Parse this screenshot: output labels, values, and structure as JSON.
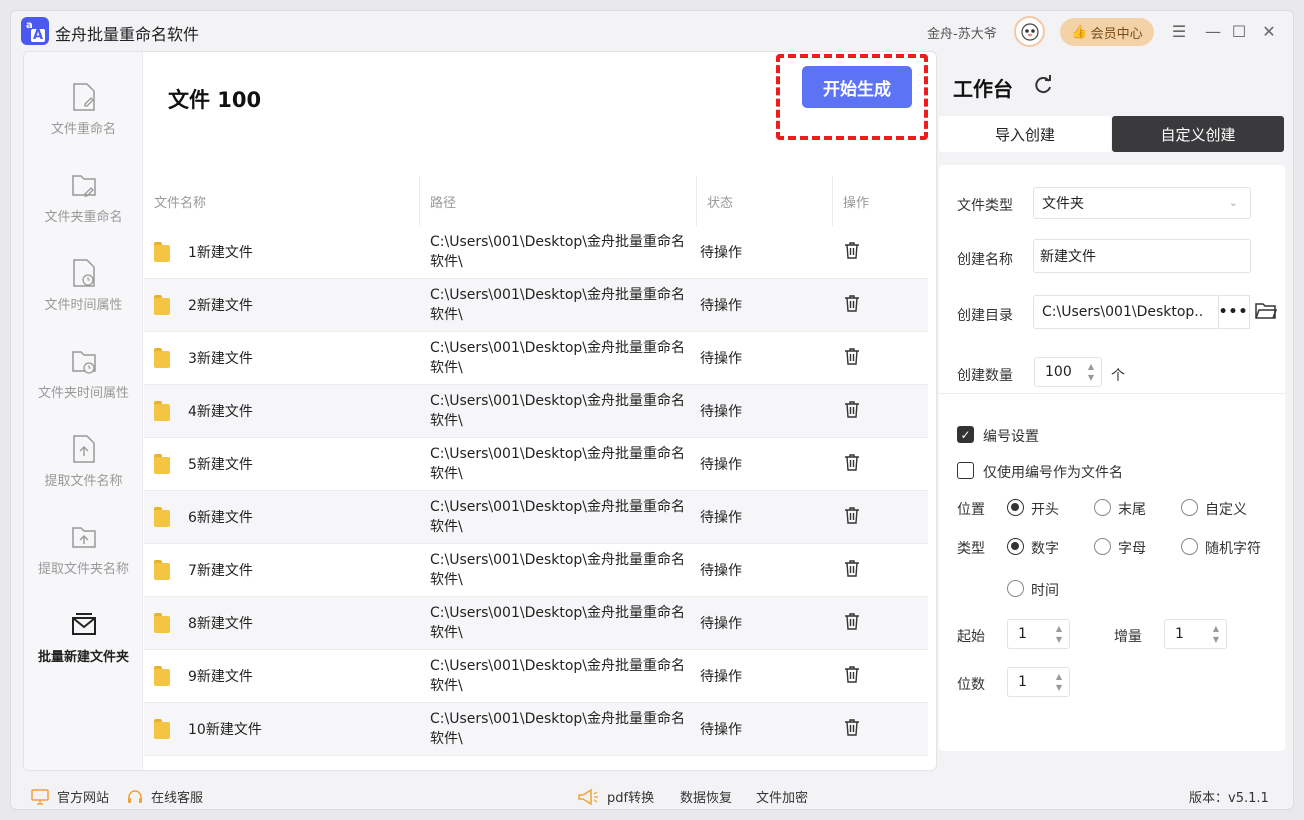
{
  "app": {
    "title": "金舟批量重命名软件",
    "logo_top": "a",
    "logo_bottom": "A"
  },
  "header": {
    "user_name": "金舟-苏大爷",
    "vip_label": "会员中心"
  },
  "sidebar": {
    "items": [
      {
        "label": "文件重命名"
      },
      {
        "label": "文件夹重命名"
      },
      {
        "label": "文件时间属性"
      },
      {
        "label": "文件夹时间属性"
      },
      {
        "label": "提取文件名称"
      },
      {
        "label": "提取文件夹名称"
      },
      {
        "label": "批量新建文件夹"
      }
    ]
  },
  "main": {
    "file_count": "文件 100",
    "start_label": "开始生成",
    "columns": [
      "文件名称",
      "路径",
      "状态",
      "操作"
    ],
    "rows": [
      {
        "name": "1新建文件",
        "path": "C:\\Users\\001\\Desktop\\金舟批量重命名软件\\",
        "status": "待操作"
      },
      {
        "name": "2新建文件",
        "path": "C:\\Users\\001\\Desktop\\金舟批量重命名软件\\",
        "status": "待操作"
      },
      {
        "name": "3新建文件",
        "path": "C:\\Users\\001\\Desktop\\金舟批量重命名软件\\",
        "status": "待操作"
      },
      {
        "name": "4新建文件",
        "path": "C:\\Users\\001\\Desktop\\金舟批量重命名软件\\",
        "status": "待操作"
      },
      {
        "name": "5新建文件",
        "path": "C:\\Users\\001\\Desktop\\金舟批量重命名软件\\",
        "status": "待操作"
      },
      {
        "name": "6新建文件",
        "path": "C:\\Users\\001\\Desktop\\金舟批量重命名软件\\",
        "status": "待操作"
      },
      {
        "name": "7新建文件",
        "path": "C:\\Users\\001\\Desktop\\金舟批量重命名软件\\",
        "status": "待操作"
      },
      {
        "name": "8新建文件",
        "path": "C:\\Users\\001\\Desktop\\金舟批量重命名软件\\",
        "status": "待操作"
      },
      {
        "name": "9新建文件",
        "path": "C:\\Users\\001\\Desktop\\金舟批量重命名软件\\",
        "status": "待操作"
      },
      {
        "name": "10新建文件",
        "path": "C:\\Users\\001\\Desktop\\金舟批量重命名软件\\",
        "status": "待操作"
      }
    ]
  },
  "workbench": {
    "title": "工作台",
    "tabs": [
      "导入创建",
      "自定义创建"
    ],
    "file_type_label": "文件类型",
    "file_type_value": "文件夹",
    "create_name_label": "创建名称",
    "create_name_value": "新建文件",
    "create_dir_label": "创建目录",
    "create_dir_value": "C:\\Users\\001\\Desktop..",
    "dir_more": "•••",
    "create_count_label": "创建数量",
    "create_count_value": "100",
    "count_unit": "个",
    "numbering_label": "编号设置",
    "numbering_checked": true,
    "only_number_label": "仅使用编号作为文件名",
    "only_number_checked": false,
    "position_label": "位置",
    "position_options": [
      "开头",
      "末尾",
      "自定义"
    ],
    "position_selected": "开头",
    "type_label": "类型",
    "type_options": [
      "数字",
      "字母",
      "随机字符",
      "时间"
    ],
    "type_selected": "数字",
    "start_label": "起始",
    "start_value": "1",
    "increment_label": "增量",
    "increment_value": "1",
    "digits_label": "位数",
    "digits_value": "1"
  },
  "footer": {
    "official_site": "官方网站",
    "online_service": "在线客服",
    "pdf_convert": "pdf转换",
    "data_recovery": "数据恢复",
    "file_encrypt": "文件加密",
    "version": "版本：v5.1.1"
  },
  "colors": {
    "accent": "#5d73f5",
    "highlight": "#ee1d1d",
    "dark_tab": "#3a3a3d",
    "vip": "#f3d2a7"
  }
}
